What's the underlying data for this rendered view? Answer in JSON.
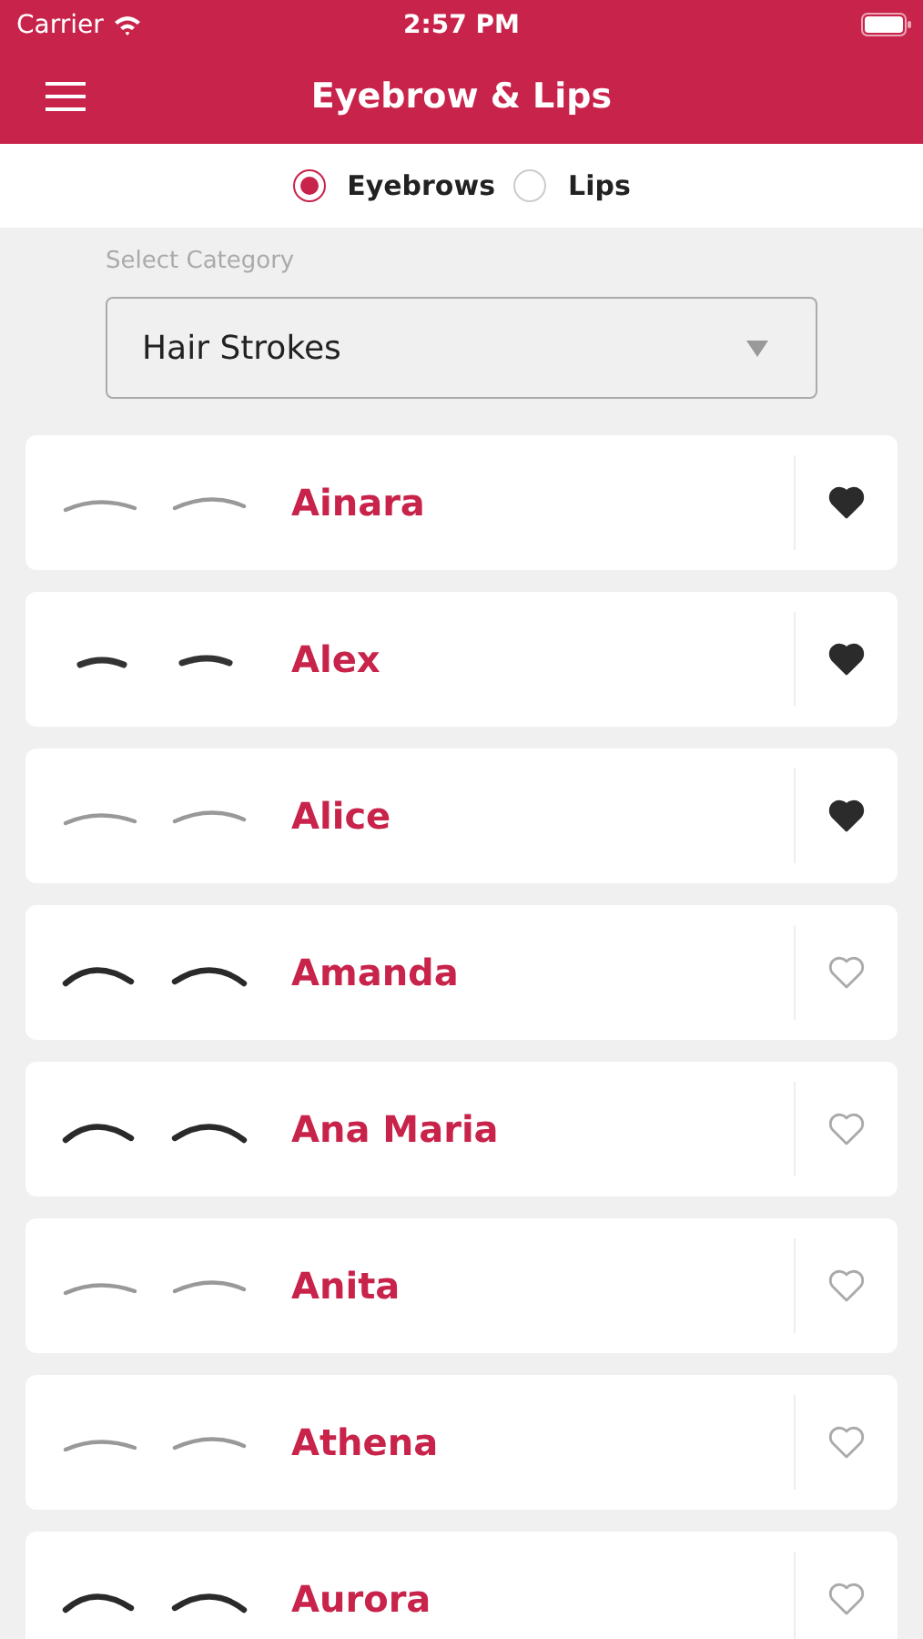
{
  "status_bar": {
    "carrier": "Carrier",
    "time": "2:57 PM"
  },
  "nav": {
    "title": "Eyebrow & Lips"
  },
  "options": [
    {
      "label": "Eyebrows",
      "selected": true
    },
    {
      "label": "Lips",
      "selected": false
    }
  ],
  "category": {
    "label": "Select Category",
    "value": "Hair Strokes"
  },
  "items": [
    {
      "name": "Ainara",
      "kind": "thin",
      "favorite": true
    },
    {
      "name": "Alex",
      "kind": "short",
      "favorite": true
    },
    {
      "name": "Alice",
      "kind": "thin",
      "favorite": true
    },
    {
      "name": "Amanda",
      "kind": "arched",
      "favorite": false
    },
    {
      "name": "Ana Maria",
      "kind": "arched",
      "favorite": false
    },
    {
      "name": "Anita",
      "kind": "thin",
      "favorite": false
    },
    {
      "name": "Athena",
      "kind": "thin",
      "favorite": false
    },
    {
      "name": "Aurora",
      "kind": "arched",
      "favorite": false
    }
  ]
}
